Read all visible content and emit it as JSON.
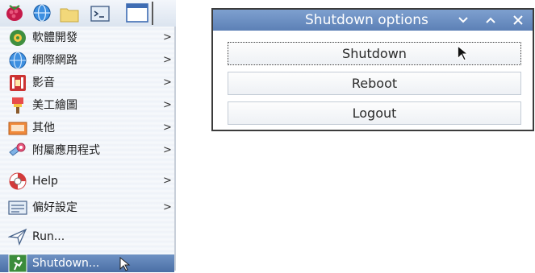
{
  "taskbar": {
    "icons": [
      "raspberry-icon",
      "globe-icon",
      "folder-icon",
      "terminal-icon",
      "window-icon"
    ]
  },
  "menu": {
    "items": [
      {
        "label": "軟體開發",
        "icon": "programming-icon",
        "has_submenu": true
      },
      {
        "label": "網際網路",
        "icon": "internet-globe-icon",
        "has_submenu": true
      },
      {
        "label": "影音",
        "icon": "sound-video-icon",
        "has_submenu": true
      },
      {
        "label": "美工繪圖",
        "icon": "graphics-icon",
        "has_submenu": true
      },
      {
        "label": "其他",
        "icon": "other-icon",
        "has_submenu": true
      },
      {
        "label": "附屬應用程式",
        "icon": "accessories-icon",
        "has_submenu": true
      },
      {
        "label": "Help",
        "icon": "help-lifebuoy-icon",
        "has_submenu": true
      },
      {
        "label": "偏好設定",
        "icon": "preferences-icon",
        "has_submenu": true
      },
      {
        "label": "Run...",
        "icon": "run-icon",
        "has_submenu": false
      },
      {
        "label": "Shutdown...",
        "icon": "shutdown-icon",
        "has_submenu": false,
        "selected": true
      }
    ],
    "arrow": ">"
  },
  "dialog": {
    "title": "Shutdown options",
    "buttons": {
      "shutdown": "Shutdown",
      "reboot": "Reboot",
      "logout": "Logout"
    },
    "focused_button": "shutdown"
  },
  "colors": {
    "titlebar": "#6a8cc2",
    "selection": "#5a7db3",
    "menu_bg": "#f3f6fa"
  }
}
